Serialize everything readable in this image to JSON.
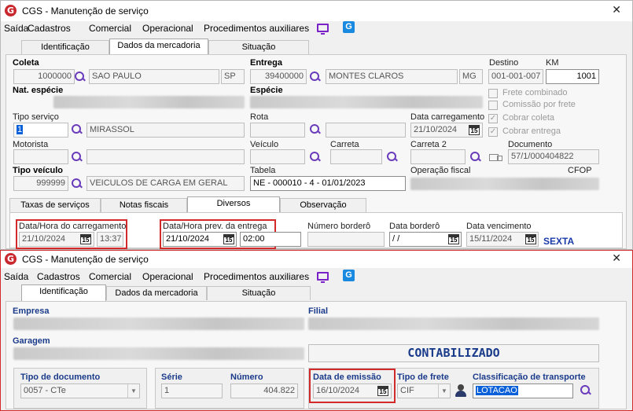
{
  "window1": {
    "title": "CGS - Manutenção de serviço",
    "menu": [
      "Saída",
      "Cadastros",
      "Comercial",
      "Operacional",
      "Procedimentos auxiliares"
    ],
    "tabs": [
      "Identificação",
      "Dados da mercadoria",
      "Situação"
    ],
    "active_tab": "Dados da mercadoria",
    "coleta": {
      "label": "Coleta",
      "code": "1000000",
      "city": "SAO PAULO",
      "uf": "SP"
    },
    "entrega": {
      "label": "Entrega",
      "code": "39400000",
      "city": "MONTES CLAROS",
      "uf": "MG"
    },
    "destino": {
      "label": "Destino",
      "value": "001-001-007"
    },
    "km": {
      "label": "KM",
      "value": "1001"
    },
    "nat_especie": {
      "label": "Nat. espécie"
    },
    "especie": {
      "label": "Espécie"
    },
    "frete_combinado": "Frete combinado",
    "comissao_por_frete": "Comissão por frete",
    "cobrar_coleta": "Cobrar coleta",
    "cobrar_entrega": "Cobrar entrega",
    "tipo_servico": {
      "label": "Tipo serviço",
      "code": "1",
      "name": "MIRASSOL"
    },
    "rota": {
      "label": "Rota"
    },
    "data_carregamento": {
      "label": "Data carregamento",
      "value": "21/10/2024"
    },
    "motorista": {
      "label": "Motorista"
    },
    "veiculo": {
      "label": "Veículo"
    },
    "carreta": {
      "label": "Carreta"
    },
    "carreta2": {
      "label": "Carreta 2"
    },
    "documento": {
      "label": "Documento",
      "value": "57/1/000404822"
    },
    "tipo_veiculo": {
      "label": "Tipo veículo",
      "code": "999999",
      "name": "VEICULOS DE CARGA EM GERAL"
    },
    "tabela": {
      "label": "Tabela",
      "value": "NE - 000010 - 4 - 01/01/2023"
    },
    "operacao_fiscal": {
      "label": "Operação fiscal"
    },
    "cfop": {
      "label": "CFOP"
    },
    "subtabs": [
      "Taxas de serviços",
      "Notas fiscais",
      "Diversos",
      "Observação"
    ],
    "active_subtab": "Diversos",
    "dh_carregamento": {
      "label": "Data/Hora do carregamento",
      "date": "21/10/2024",
      "time": "13:37"
    },
    "dh_prev_entrega": {
      "label": "Data/Hora prev. da entrega",
      "date": "21/10/2024",
      "time": "02:00"
    },
    "numero_bordero": {
      "label": "Número borderô"
    },
    "data_bordero": {
      "label": "Data borderô",
      "value": " /  /"
    },
    "data_vencimento": {
      "label": "Data vencimento",
      "value": "15/11/2024"
    },
    "weekday": "SEXTA",
    "cal_label": "15"
  },
  "window2": {
    "title": "CGS - Manutenção de serviço",
    "menu": [
      "Saída",
      "Cadastros",
      "Comercial",
      "Operacional",
      "Procedimentos auxiliares"
    ],
    "tabs": [
      "Identificação",
      "Dados da mercadoria",
      "Situação"
    ],
    "active_tab": "Identificação",
    "empresa": "Empresa",
    "filial": "Filial",
    "garagem": "Garagem",
    "status": "CONTABILIZADO",
    "tipo_documento": {
      "label": "Tipo de documento",
      "value": "0057 - CTe"
    },
    "serie": {
      "label": "Série",
      "value": "1"
    },
    "numero": {
      "label": "Número",
      "value": "404.822"
    },
    "data_emissao": {
      "label": "Data de emissão",
      "value": "16/10/2024"
    },
    "tipo_frete": {
      "label": "Tipo de frete",
      "value": "CIF"
    },
    "classificacao": {
      "label": "Classificação de transporte",
      "value": "LOTACAO"
    },
    "cal_label": "15"
  }
}
